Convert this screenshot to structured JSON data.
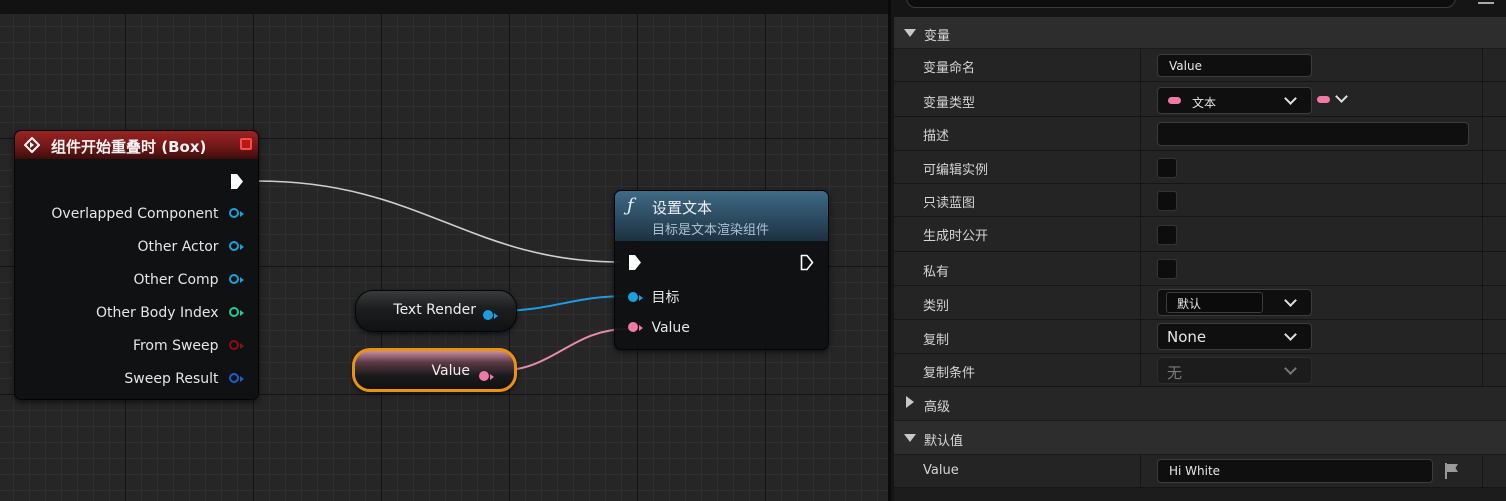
{
  "graph": {
    "event_node": {
      "title": "组件开始重叠时 (Box)",
      "pins": [
        {
          "label": "Overlapped Component",
          "color": "#1a9fe0"
        },
        {
          "label": "Other Actor",
          "color": "#1a9fe0"
        },
        {
          "label": "Other Comp",
          "color": "#1a9fe0"
        },
        {
          "label": "Other Body Index",
          "color": "#27c98e"
        },
        {
          "label": "From Sweep",
          "color": "#8a1010"
        },
        {
          "label": "Sweep Result",
          "color": "#1a5fd0"
        }
      ]
    },
    "set_text_node": {
      "title": "设置文本",
      "subtitle": "目标是文本渲染组件",
      "pin_target": "目标",
      "pin_value": "Value"
    },
    "text_render_node": {
      "label": "Text Render"
    },
    "value_node": {
      "label": "Value"
    },
    "colors": {
      "object_pin": "#1a9fe0",
      "text_pin": "#f07aa5",
      "exec_wire": "#cfcfcf",
      "selection": "#e8940e"
    }
  },
  "panel": {
    "section_variables": "变量",
    "rows": [
      {
        "label": "变量命名",
        "value": "Value"
      },
      {
        "label": "变量类型",
        "value": "文本"
      },
      {
        "label": "描述",
        "value": ""
      },
      {
        "label": "可编辑实例"
      },
      {
        "label": "只读蓝图"
      },
      {
        "label": "生成时公开"
      },
      {
        "label": "私有"
      },
      {
        "label": "类别",
        "value": "默认"
      },
      {
        "label": "复制",
        "value": "None"
      },
      {
        "label": "复制条件",
        "value": "无"
      }
    ],
    "section_advanced": "高级",
    "section_default": "默认值",
    "default_row": {
      "label": "Value",
      "value": "Hi White"
    }
  }
}
